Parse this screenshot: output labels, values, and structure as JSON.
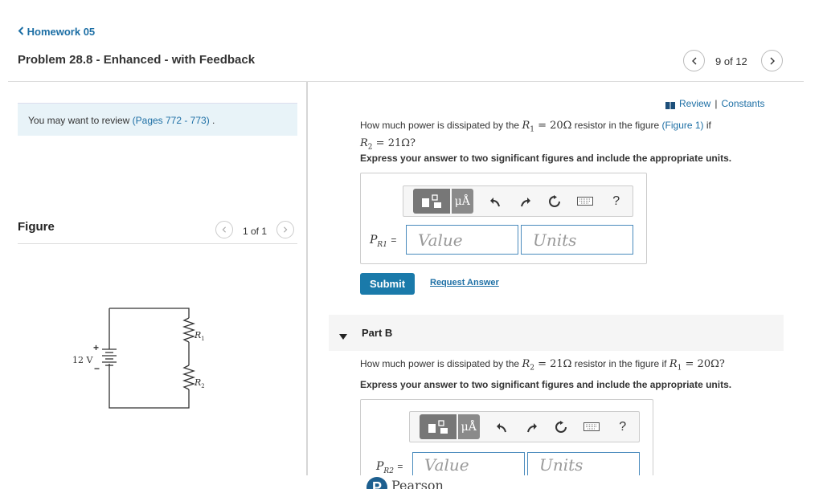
{
  "header": {
    "back_label": "Homework 05",
    "problem_title": "Problem 28.8 - Enhanced - with Feedback",
    "pager": "9 of 12"
  },
  "review": {
    "text": "You may want to review",
    "link": "(Pages 772 - 773)",
    "end": "."
  },
  "figure": {
    "title": "Figure",
    "pager": "1 of 1",
    "battery_label": "12 V",
    "plus": "+",
    "minus": "−",
    "r1_label": "R",
    "r1_sub": "1",
    "r2_label": "R",
    "r2_sub": "2"
  },
  "links": {
    "review_label": "Review",
    "sep": " | ",
    "constants_label": "Constants"
  },
  "part_a": {
    "q_pre": "How much power is dissipated by the",
    "q_eq1": "R",
    "q_eq1_sub": "1",
    "q_eq1_val": " = 20Ω",
    "q_mid": "resistor in the figure",
    "q_fig": "(Figure 1)",
    "q_if": "if",
    "q_eq2": "R",
    "q_eq2_sub": "2",
    "q_eq2_val": " = 21Ω?",
    "instruction": "Express your answer to two significant figures and include the appropriate units.",
    "label_p": "P",
    "label_sub": "R1",
    "label_eq": "=",
    "value_placeholder": "Value",
    "units_placeholder": "Units",
    "submit_label": "Submit",
    "request_label": "Request Answer"
  },
  "part_b": {
    "title": "Part B",
    "q_pre": "How much power is dissipated by the",
    "q_eq1": "R",
    "q_eq1_sub": "2",
    "q_eq1_val": " = 21Ω",
    "q_mid": "resistor in the figure if",
    "q_eq2": "R",
    "q_eq2_sub": "1",
    "q_eq2_val": " = 20Ω?",
    "instruction": "Express your answer to two significant figures and include the appropriate units.",
    "label_p": "P",
    "label_sub": "R2",
    "label_eq": "=",
    "value_placeholder": "Value",
    "units_placeholder": "Units"
  },
  "toolbar": {
    "units_glyph": "μÅ",
    "help": "?"
  },
  "footer": {
    "brand": "Pearson"
  }
}
